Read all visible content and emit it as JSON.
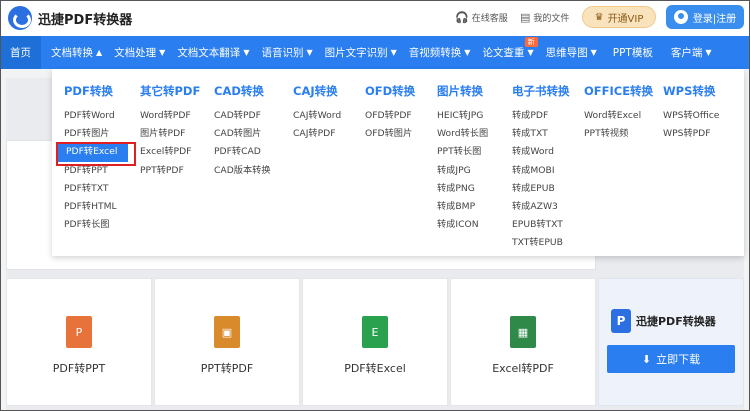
{
  "header": {
    "logo_text": "迅捷PDF转换器",
    "service_label": "在线客服",
    "files_label": "我的文件",
    "vip_label": "开通VIP",
    "login_label": "登录|注册"
  },
  "nav": {
    "home": "首页",
    "items": [
      {
        "label": "文档转换",
        "arrow": "▲"
      },
      {
        "label": "文档处理",
        "arrow": "▼"
      },
      {
        "label": "文档文本翻译",
        "arrow": "▼"
      },
      {
        "label": "语音识别",
        "arrow": "▼"
      },
      {
        "label": "图片文字识别",
        "arrow": "▼"
      },
      {
        "label": "音视频转换",
        "arrow": "▼"
      },
      {
        "label": "论文查重",
        "arrow": "▼",
        "badge": "新"
      },
      {
        "label": "思维导图",
        "arrow": "▼"
      },
      {
        "label": "PPT模板",
        "arrow": ""
      },
      {
        "label": "客户端",
        "arrow": "▼"
      }
    ]
  },
  "dropdown": {
    "columns": [
      {
        "title": "PDF转换",
        "items": [
          "PDF转Word",
          "PDF转图片",
          "PDF转Excel",
          "PDF转PPT",
          "PDF转TXT",
          "PDF转HTML",
          "PDF转长图"
        ]
      },
      {
        "title": "其它转PDF",
        "items": [
          "Word转PDF",
          "图片转PDF",
          "Excel转PDF",
          "PPT转PDF"
        ]
      },
      {
        "title": "CAD转换",
        "items": [
          "CAD转PDF",
          "CAD转图片",
          "PDF转CAD",
          "CAD版本转换"
        ]
      },
      {
        "title": "CAJ转换",
        "items": [
          "CAJ转Word",
          "CAJ转PDF"
        ]
      },
      {
        "title": "OFD转换",
        "items": [
          "OFD转PDF",
          "OFD转图片"
        ]
      },
      {
        "title": "图片转换",
        "items": [
          "HEIC转JPG",
          "Word转长图",
          "PPT转长图",
          "转成JPG",
          "转成PNG",
          "转成BMP",
          "转成ICON"
        ]
      },
      {
        "title": "电子书转换",
        "items": [
          "转成PDF",
          "转成TXT",
          "转成Word",
          "转成MOBI",
          "转成EPUB",
          "转成AZW3",
          "EPUB转TXT",
          "TXT转EPUB"
        ]
      },
      {
        "title": "OFFICE转换",
        "items": [
          "Word转Excel",
          "PPT转视频"
        ]
      },
      {
        "title": "WPS转换",
        "items": [
          "WPS转Office",
          "WPS转PDF"
        ]
      }
    ],
    "highlighted": "PDF转Excel"
  },
  "tiles": [
    {
      "label": "PDF转PPT",
      "icon_text": "P",
      "color": "#e8733a"
    },
    {
      "label": "PPT转PDF",
      "icon_text": "▣",
      "color": "#d98a2b"
    },
    {
      "label": "PDF转Excel",
      "icon_text": "E",
      "color": "#2aa14f"
    },
    {
      "label": "Excel转PDF",
      "icon_text": "▦",
      "color": "#2f8a4a"
    }
  ],
  "promo": {
    "title": "迅捷PDF转换器",
    "download_label": "立即下载"
  }
}
